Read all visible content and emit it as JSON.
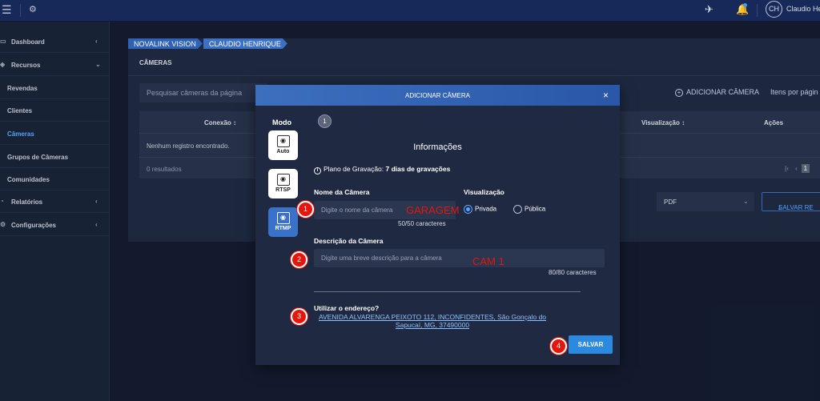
{
  "topbar": {
    "user_initials": "CH",
    "user_name": "Claudio He"
  },
  "sidebar": {
    "items": [
      {
        "label": "Dashboard"
      },
      {
        "label": "Recursos"
      },
      {
        "label": "Revendas"
      },
      {
        "label": "Clientes"
      },
      {
        "label": "Câmeras"
      },
      {
        "label": "Grupos de Câmeras"
      },
      {
        "label": "Comunidades"
      },
      {
        "label": "Relatórios"
      },
      {
        "label": "Configurações"
      }
    ]
  },
  "breadcrumb": [
    "NOVALINK VISION",
    "CLAUDIO HENRIQUE"
  ],
  "page": {
    "title": "CÂMERAS",
    "search_placeholder": "Pesquisar câmeras da página",
    "add_camera": "ADICIONAR CÂMERA",
    "items_per_page": "Itens por págin",
    "table": {
      "columns": [
        "Conexão ↕",
        "Visualização ↕",
        "Ações"
      ],
      "empty": "Nenhum registro encontrado.",
      "results": "0 resultados",
      "page": "1"
    },
    "export_format": "PDF",
    "save_report": "SALVAR RE"
  },
  "modal": {
    "title": "ADICIONAR CÂMERA",
    "mode_label": "Modo",
    "modes": [
      "Auto",
      "RTSP",
      "RTMP"
    ],
    "selected_mode": "RTMP",
    "step": "1",
    "section_title": "Informações",
    "plan_prefix": "Plano de Gravação:",
    "plan_value": "7 dias de gravações",
    "name_label": "Nome da Câmera",
    "name_placeholder": "Digite o nome da câmera",
    "name_counter": "50/50 caracteres",
    "visibility_label": "Visualização",
    "visibility_options": [
      "Privada",
      "Pública"
    ],
    "visibility_selected": "Privada",
    "desc_label": "Descrição da Câmera",
    "desc_placeholder": "Digite uma breve descrição para a câmera",
    "desc_counter": "80/80 caracteres",
    "address_label": "Utilizar o endereço?",
    "address": "AVENIDA ALVARENGA PEIXOTO 112, INCONFIDENTES, São Gonçalo do Sapucaí, MG, 37490000",
    "save": "SALVAR"
  },
  "annotations": {
    "markers": [
      "1",
      "2",
      "3",
      "4"
    ],
    "handwritten_name": "GARAGEM",
    "handwritten_desc": "CAM 1",
    "color": "#e3170e"
  }
}
